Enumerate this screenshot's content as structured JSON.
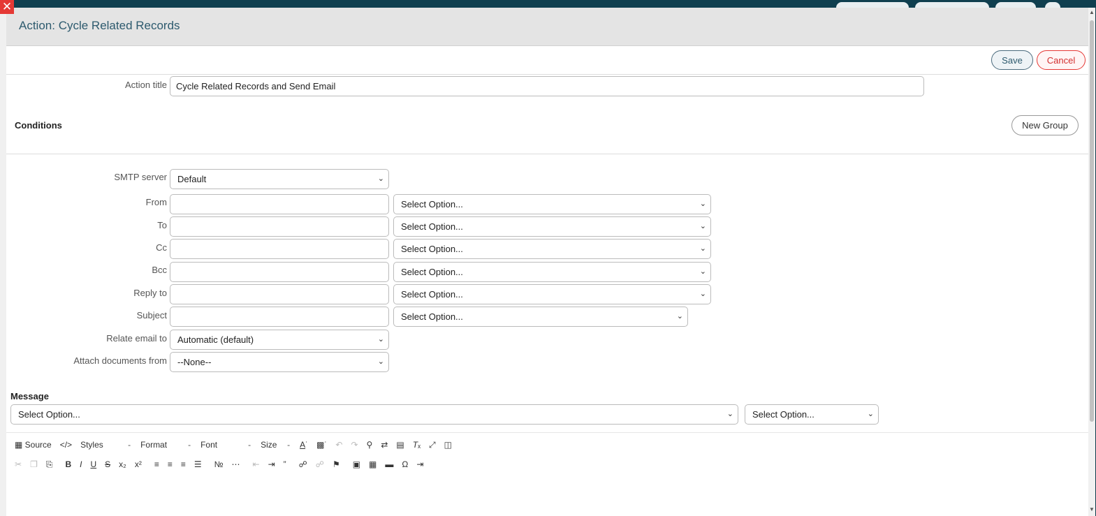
{
  "dialog": {
    "title": "Action: Cycle Related Records",
    "close_glyph": "✕"
  },
  "toolbar_buttons": {
    "save": "Save",
    "cancel": "Cancel"
  },
  "action_title": {
    "label": "Action title",
    "value": "Cycle Related Records and Send Email"
  },
  "conditions": {
    "title": "Conditions",
    "new_group": "New Group"
  },
  "email": {
    "smtp": {
      "label": "SMTP server",
      "value": "Default"
    },
    "rows": [
      {
        "label": "From",
        "value": "",
        "option": "Select Option..."
      },
      {
        "label": "To",
        "value": "",
        "option": "Select Option..."
      },
      {
        "label": "Cc",
        "value": "",
        "option": "Select Option..."
      },
      {
        "label": "Bcc",
        "value": "",
        "option": "Select Option..."
      },
      {
        "label": "Reply to",
        "value": "",
        "option": "Select Option..."
      },
      {
        "label": "Subject",
        "value": "",
        "option": "Select Option..."
      }
    ],
    "relate": {
      "label": "Relate email to",
      "value": "Automatic (default)"
    },
    "attach": {
      "label": "Attach documents from",
      "value": "--None--"
    }
  },
  "message": {
    "title": "Message",
    "select1": "Select Option...",
    "select2": "Select Option..."
  },
  "editor": {
    "source": "Source",
    "styles": "Styles",
    "format": "Format",
    "font": "Font",
    "size": "Size",
    "row1_icons": [
      "code-snippet-icon",
      "text-color-icon",
      "bg-color-icon",
      "undo-icon",
      "redo-icon",
      "find-icon",
      "replace-icon",
      "select-all-icon",
      "remove-format-icon",
      "maximize-icon",
      "show-blocks-icon"
    ],
    "row2_icons": [
      "cut-icon",
      "copy-icon",
      "paste-icon",
      "bold-icon",
      "italic-icon",
      "underline-icon",
      "strike-icon",
      "subscript-icon",
      "superscript-icon",
      "align-left-icon",
      "align-center-icon",
      "align-right-icon",
      "justify-icon",
      "numbered-list-icon",
      "bulleted-list-icon",
      "outdent-icon",
      "indent-icon",
      "blockquote-icon",
      "link-icon",
      "unlink-icon",
      "anchor-icon",
      "image-icon",
      "table-icon",
      "horizontal-line-icon",
      "special-char-icon",
      "page-break-icon"
    ]
  }
}
